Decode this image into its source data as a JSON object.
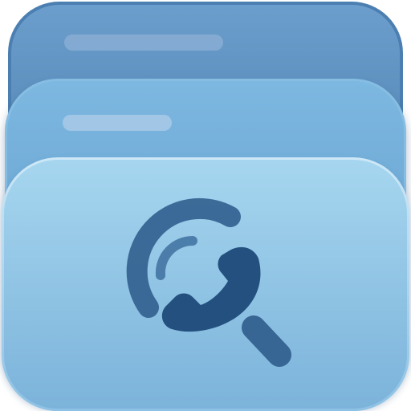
{
  "app_icon": {
    "name": "phone-search-app-icon",
    "colors": {
      "back_card_top": "#5E93C4",
      "back_card_bottom": "#3E6F9F",
      "middle_card_top": "#79B4DF",
      "middle_card_bottom": "#5C97C8",
      "front_card_top": "#A2D4EE",
      "front_card_bottom": "#7FB6DD",
      "glyph": "#2E5A8B",
      "label_bar": "#A9C7E5"
    },
    "glyph_icon": "magnifier-with-phone-handset-icon"
  }
}
